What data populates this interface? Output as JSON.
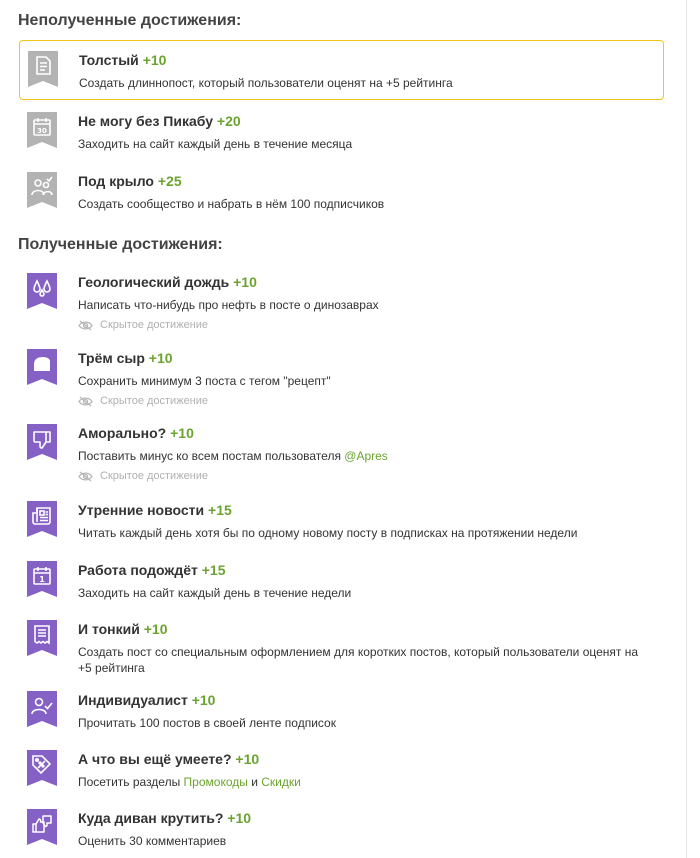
{
  "sections": {
    "locked_title": "Неполученные достижения:",
    "earned_title": "Полученные достижения:"
  },
  "hidden_label": "Скрытое достижение",
  "colors": {
    "accent_green": "#6ba32f",
    "earned_purple": "#8561c5",
    "locked_gray": "#b3b3b3",
    "highlight_border": "#f5c518"
  },
  "locked": [
    {
      "icon": "document-icon",
      "title": "Толстый",
      "points": "+10",
      "desc": "Создать длиннопост, который пользователи оценят на +5 рейтинга"
    },
    {
      "icon": "calendar-30-icon",
      "title": "Не могу без Пикабу",
      "points": "+20",
      "desc": "Заходить на сайт каждый день в течение месяца"
    },
    {
      "icon": "community-icon",
      "title": "Под крыло",
      "points": "+25",
      "desc": "Создать сообщество и набрать в нём 100 подписчиков"
    }
  ],
  "earned": [
    {
      "icon": "drops-icon",
      "title": "Геологический дождь",
      "points": "+10",
      "desc": "Написать что-нибудь про нефть в посте о динозаврах"
    },
    {
      "icon": "cheese-icon",
      "title": "Трём сыр",
      "points": "+10",
      "desc": "Сохранить минимум 3 поста с тегом \"рецепт\""
    },
    {
      "icon": "thumbs-down-icon",
      "title": "Аморально?",
      "points": "+10",
      "desc_prefix": "Поставить минус ко всем постам пользователя ",
      "desc_link": "@Apres"
    },
    {
      "icon": "newspaper-icon",
      "title": "Утренние новости",
      "points": "+15",
      "desc": "Читать каждый день хотя бы по одному новому посту в подписках на протяжении недели"
    },
    {
      "icon": "calendar-1-icon",
      "title": "Работа подождёт",
      "points": "+15",
      "desc": "Заходить на сайт каждый день в течение недели"
    },
    {
      "icon": "receipt-icon",
      "title": "И тонкий",
      "points": "+10",
      "desc": "Создать пост со специальным оформлением для коротких постов, который пользователи оценят на +5 рейтинга"
    },
    {
      "icon": "user-check-icon",
      "title": "Индивидуалист",
      "points": "+10",
      "desc": "Прочитать 100 постов в своей ленте подписок"
    },
    {
      "icon": "discount-tag-icon",
      "title": "А что вы ещё умеете?",
      "points": "+10",
      "desc_prefix": "Посетить разделы ",
      "link1": "Промокоды",
      "desc_mid": " и ",
      "link2": "Скидки"
    },
    {
      "icon": "thumbs-up-down-icon",
      "title": "Куда диван крутить?",
      "points": "+10",
      "desc": "Оценить 30 комментариев"
    }
  ]
}
